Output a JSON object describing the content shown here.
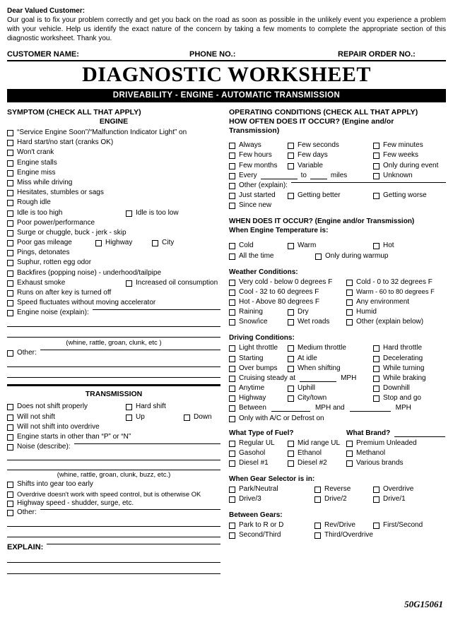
{
  "header": {
    "greeting": "Dear Valued Customer:",
    "intro": "Our goal is to fix your problem correctly and get you back on the road as soon as possible in the unlikely event you experience a problem with your vehicle. Help us identify the exact nature of the concern by taking a few moments to complete the appropriate section of this diagnostic worksheet. Thank you.",
    "customer_name_label": "CUSTOMER NAME:",
    "phone_label": "PHONE NO.:",
    "repair_order_label": "REPAIR ORDER NO.:",
    "title": "DIAGNOSTIC WORKSHEET",
    "banner": "DRIVEABILITY - ENGINE - AUTOMATIC TRANSMISSION"
  },
  "symptom": {
    "heading": "SYMPTOM (CHECK ALL THAT APPLY)",
    "engine_heading": "ENGINE",
    "items": [
      "“Service Engine Soon”/“Malfunction Indicator Light” on",
      "Hard start/no start (cranks OK)",
      "Won't crank",
      "Engine stalls",
      "Engine miss",
      "Miss while driving",
      "Hesitates, stumbles or sags",
      "Rough idle"
    ],
    "idle_high": "Idle is too high",
    "idle_low": "Idle is too low",
    "poor_power": "Poor power/performance",
    "surge": "Surge or chuggle, buck - jerk - skip",
    "poor_gas": "Poor gas mileage",
    "highway": "Highway",
    "city": "City",
    "pings": "Pings, detonates",
    "suphur": "Suphur, rotten egg odor",
    "backfires": "Backfires (popping noise) - underhood/tailpipe",
    "exhaust_smoke": "Exhaust smoke",
    "oil_consumption": "Increased oil consumption",
    "runs_on": "Runs on after key is turned off",
    "speed_fluctuates": "Speed fluctuates without moving accelerator",
    "engine_noise": "Engine noise (explain):",
    "noise_caption": "(whine, rattle, groan, clunk, etc )",
    "other": "Other:"
  },
  "transmission": {
    "heading": "TRANSMISSION",
    "does_not_shift": "Does not shift properly",
    "hard_shift": "Hard shift",
    "will_not_shift": "Will not shift",
    "up": "Up",
    "down": "Down",
    "no_overdrive": "Will not shift into overdrive",
    "starts_other": "Engine starts in other than “P” or “N”",
    "noise": "Noise (describe):",
    "noise_caption": "(whine, rattle, groan, clunk, buzz, etc.)",
    "shifts_early": "Shifts into gear too early",
    "overdrive_speedcontrol": "Overdrive doesn't work with speed control, but is otherwise OK",
    "highway_shudder": "Highway speed - shudder, surge, etc.",
    "other": "Other:",
    "explain_label": "EXPLAIN:"
  },
  "operating": {
    "heading1": "OPERATING CONDITIONS (CHECK ALL THAT APPLY)",
    "heading2": "HOW OFTEN DOES IT OCCUR? (Engine and/or Transmission)",
    "freq_rows": [
      [
        "Always",
        "Few seconds",
        "Few minutes"
      ],
      [
        "Few hours",
        "Few days",
        "Few weeks"
      ],
      [
        "Few months",
        "Variable",
        "Only during event"
      ]
    ],
    "every": "Every",
    "to": "to",
    "miles": "miles",
    "unknown": "Unknown",
    "other_explain": "Other (explain):",
    "just_started": "Just started",
    "getting_better": "Getting better",
    "getting_worse": "Getting worse",
    "since_new": "Since new"
  },
  "when": {
    "heading": "WHEN DOES IT OCCUR? (Engine and/or Transmission)",
    "subheading": "When Engine Temperature is:",
    "cold": "Cold",
    "warm": "Warm",
    "hot": "Hot",
    "all_the_time": "All the time",
    "only_warmup": "Only during warmup"
  },
  "weather": {
    "heading": "Weather Conditions:",
    "rows": [
      [
        "Very cold - below 0 degrees F",
        "Cold - 0 to 32 degrees F"
      ],
      [
        "Cool - 32 to 60 degrees F",
        "Warm - 60 to 80 degrees F"
      ],
      [
        "Hot - Above 80 degrees F",
        "Any environment"
      ]
    ],
    "raining": "Raining",
    "dry": "Dry",
    "humid": "Humid",
    "snow_ice": "Snow/ice",
    "wet_roads": "Wet roads",
    "other_below": "Other (explain below)"
  },
  "driving": {
    "heading": "Driving Conditions:",
    "light_throttle": "Light throttle",
    "medium_throttle": "Medium throttle",
    "hard_throttle": "Hard throttle",
    "starting": "Starting",
    "at_idle": "At idle",
    "decelerating": "Decelerating",
    "over_bumps": "Over bumps",
    "when_shifting": "When shifting",
    "while_turning": "While turning",
    "cruising": "Cruising steady at",
    "mph": "MPH",
    "while_braking": "While braking",
    "anytime": "Anytime",
    "uphill": "Uphill",
    "downhill": "Downhill",
    "highway": "Highway",
    "city_town": "City/town",
    "stop_and_go": "Stop and go",
    "between": "Between",
    "mph_and": "MPH and",
    "mph2": "MPH",
    "only_ac": "Only with A/C or Defrost on"
  },
  "fuel": {
    "type_heading": "What Type of Fuel?",
    "brand_heading": "What Brand?",
    "regular_ul": "Regular UL",
    "mid_range_ul": "Mid range UL",
    "premium_unleaded": "Premium Unleaded",
    "gasohol": "Gasohol",
    "ethanol": "Ethanol",
    "methanol": "Methanol",
    "diesel1": "Diesel #1",
    "diesel2": "Diesel #2",
    "various_brands": "Various brands"
  },
  "gear": {
    "heading": "When Gear Selector is in:",
    "park_neutral": "Park/Neutral",
    "reverse": "Reverse",
    "overdrive": "Overdrive",
    "drive3": "Drive/3",
    "drive2": "Drive/2",
    "drive1": "Drive/1",
    "between_heading": "Between Gears:",
    "park_to_r_or_d": "Park to R or D",
    "rev_drive": "Rev/Drive",
    "first_second": "First/Second",
    "second_third": "Second/Third",
    "third_overdrive": "Third/Overdrive"
  },
  "footer": {
    "code": "50G15061"
  }
}
